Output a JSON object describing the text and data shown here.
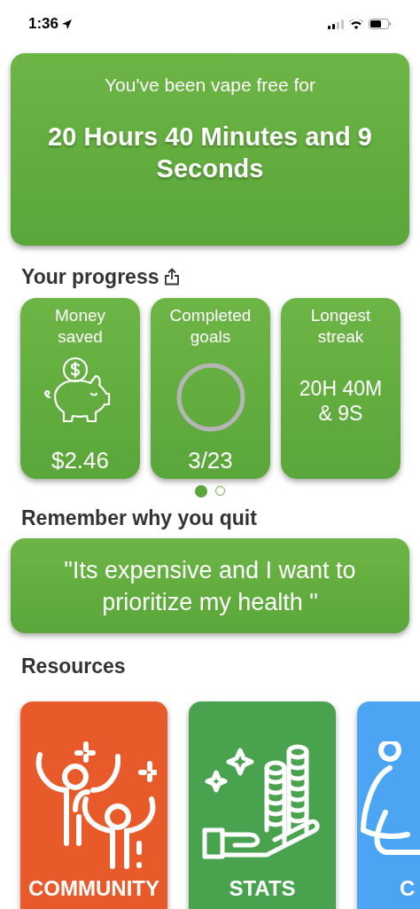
{
  "status_bar": {
    "time": "1:36"
  },
  "hero": {
    "label": "You've been vape free for",
    "duration": "20 Hours 40 Minutes and 9 Seconds"
  },
  "progress": {
    "title": "Your progress",
    "cards": [
      {
        "kind": "money",
        "title": "Money saved",
        "value": "$2.46"
      },
      {
        "kind": "goals",
        "title": "Completed goals",
        "value": "3/23",
        "level": 0
      },
      {
        "kind": "streak",
        "title": "Longest streak",
        "value": "20H 40M & 9S"
      }
    ],
    "pages": [
      {
        "selected": true
      },
      {
        "selected": false
      }
    ]
  },
  "reason": {
    "title": "Remember why you quit",
    "quote": "\"Its expensive and I want to prioritize my health \""
  },
  "resources": {
    "title": "Resources",
    "items": [
      {
        "kind": "community",
        "label": "COMMUNITY",
        "color": "#e85a2a"
      },
      {
        "kind": "stats",
        "label": "STATS",
        "color": "#49a24e"
      },
      {
        "kind": "calm",
        "label": "C",
        "color": "#4ba5f2"
      }
    ]
  }
}
